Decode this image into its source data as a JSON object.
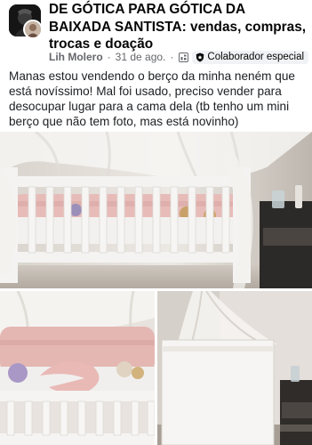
{
  "post": {
    "group_name": "DE GÓTICA PARA GÓTICA DA BAIXADA SANTISTA: vendas, compras, trocas e doação",
    "author": "Lih Molero",
    "date": "31 de ago.",
    "badge": "Colaborador especial",
    "text": "Manas estou vendendo o berço da minha neném que está novíssimo! Mal foi usado, preciso vender para desocupar lugar para a cama dela (tb tenho um mini berço que não tem foto, mas está novinho)"
  },
  "icons": {
    "group_avatar": "group-avatar-icon",
    "privacy": "group-privacy-icon",
    "badge": "shield-badge-icon"
  },
  "colors": {
    "meta_text": "#65676b",
    "badge_bg": "#f0f2f5",
    "crib_white": "#f4f3f1",
    "pink_bumper": "#e7bcb8"
  }
}
